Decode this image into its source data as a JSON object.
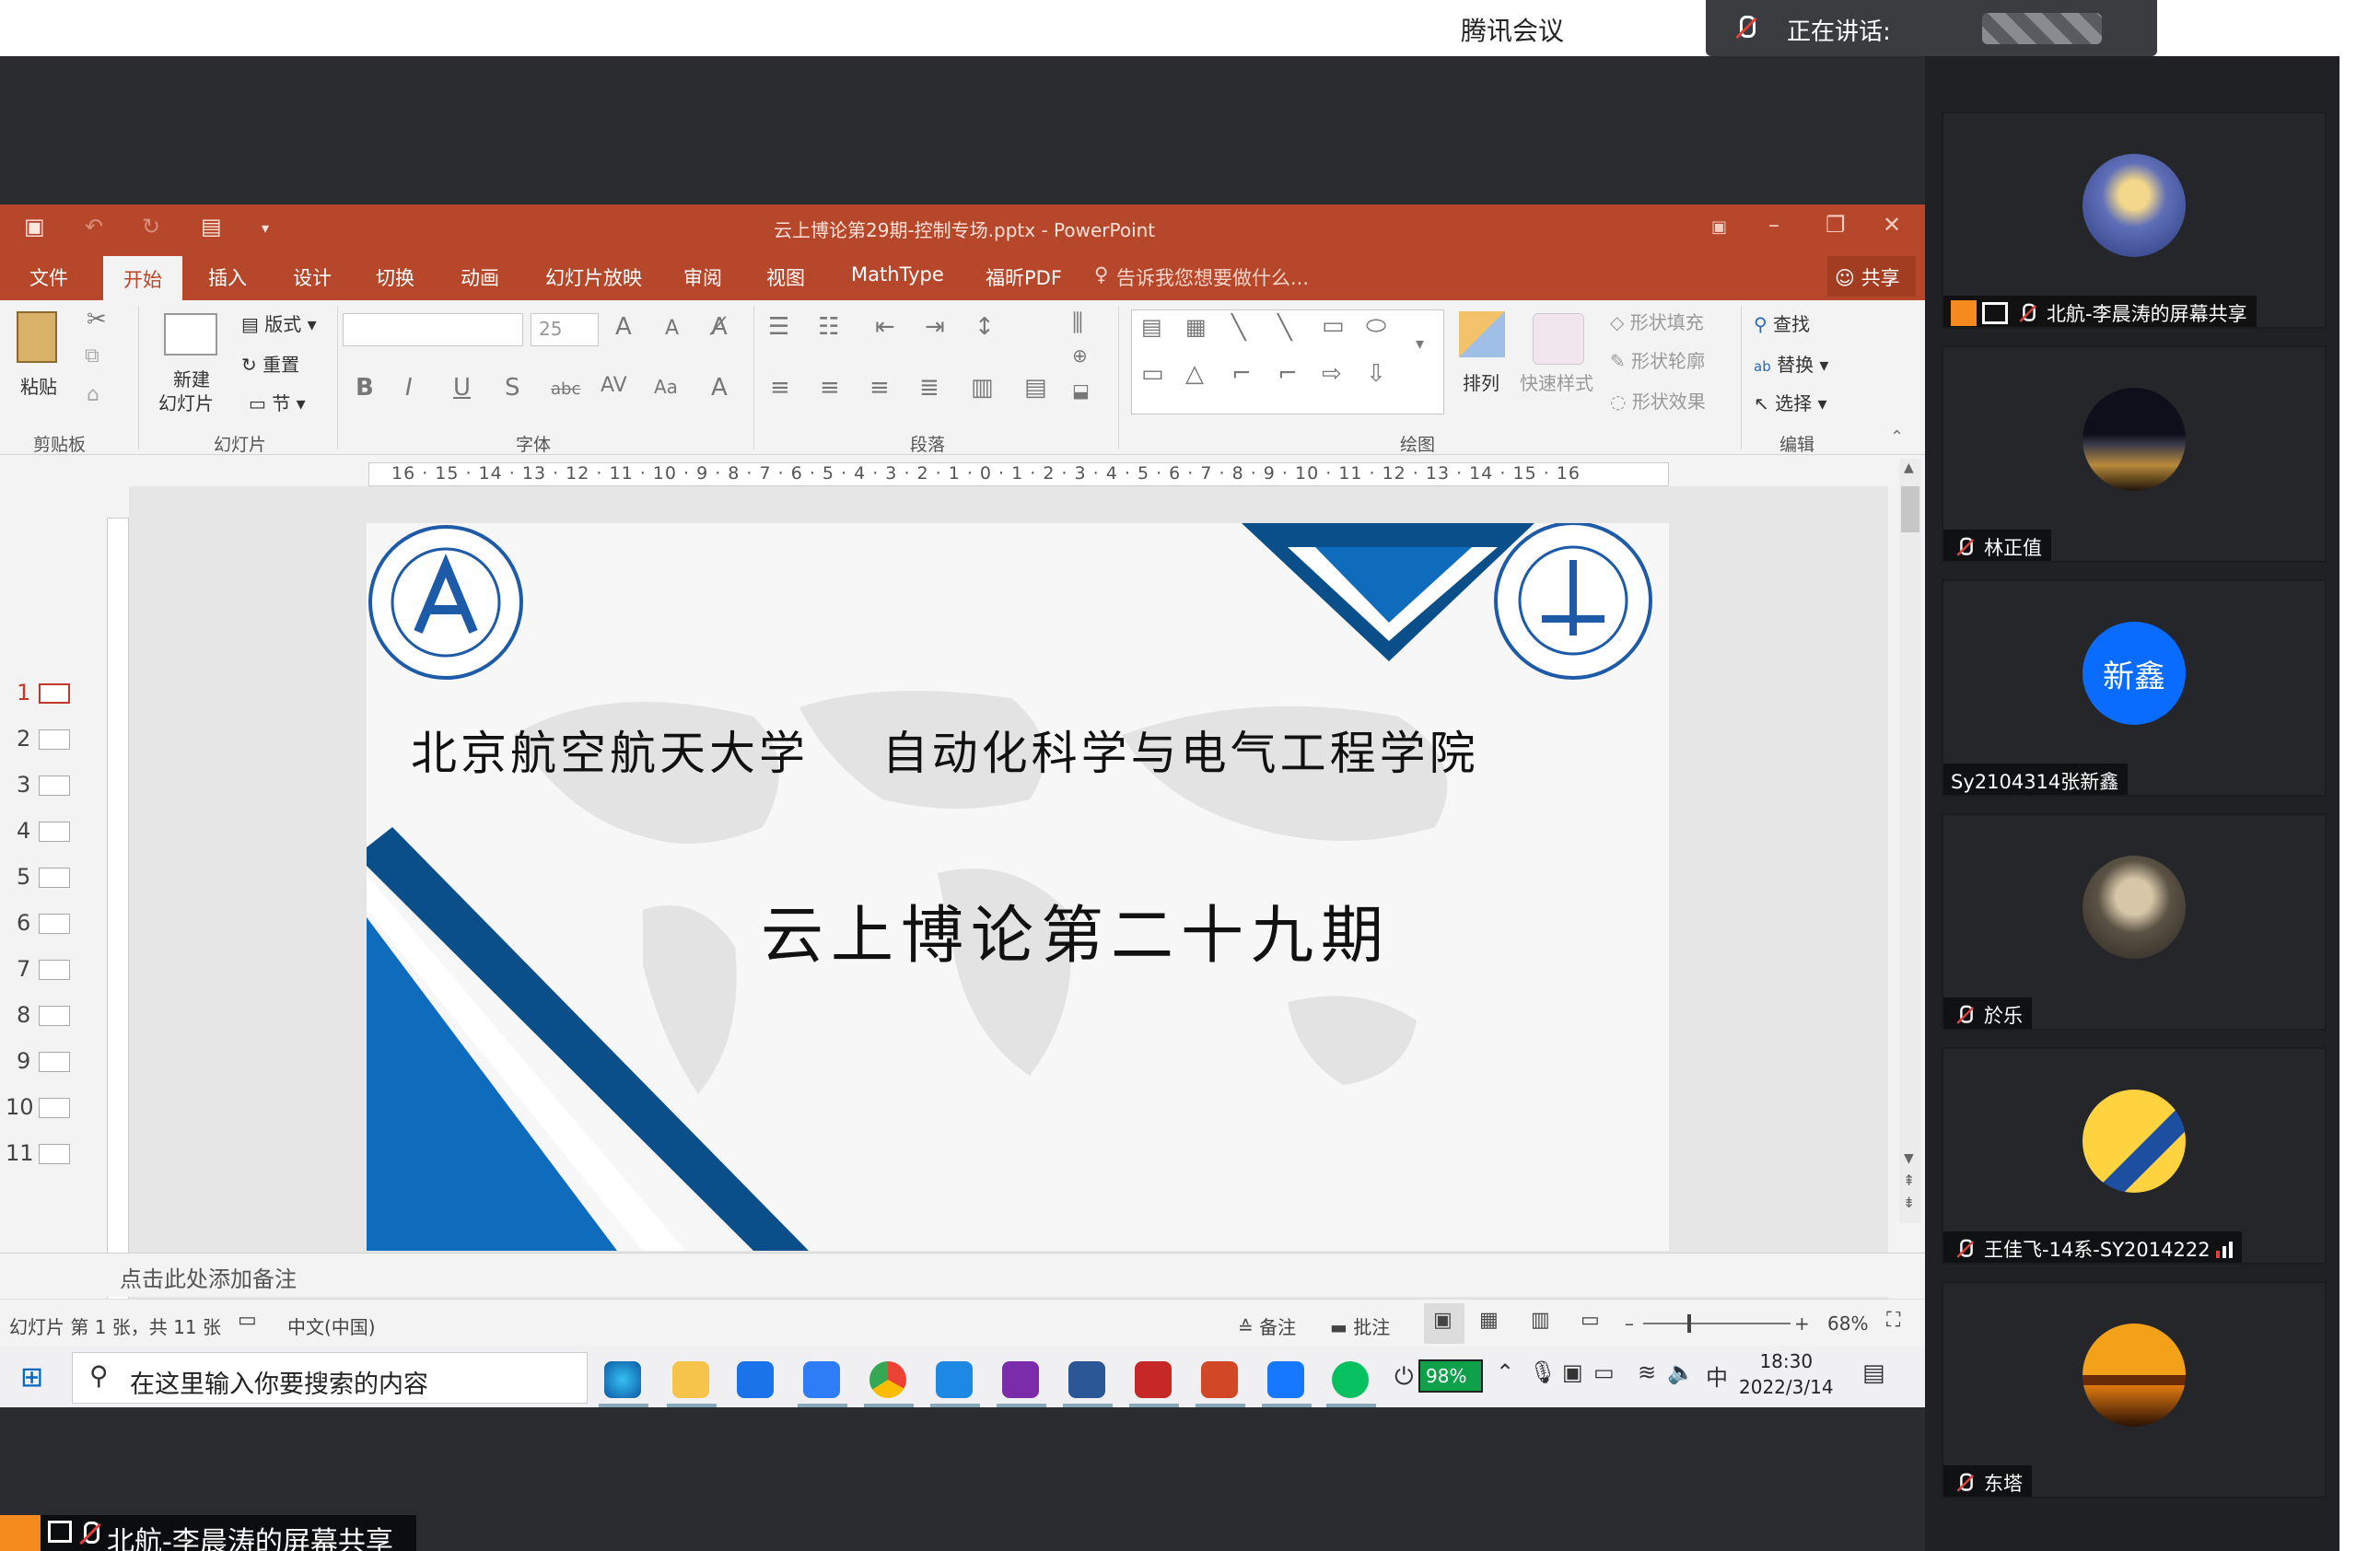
{
  "meeting": {
    "app_title": "腾讯会议",
    "speaking_label": "正在讲话:",
    "share_banner": "北航-李晨涛的屏幕共享"
  },
  "powerpoint": {
    "window_title": "云上博论第29期-控制专场.pptx - PowerPoint",
    "tabs": [
      "文件",
      "开始",
      "插入",
      "设计",
      "切换",
      "动画",
      "幻灯片放映",
      "审阅",
      "视图",
      "MathType",
      "福昕PDF"
    ],
    "active_tab": "开始",
    "tell_me": "告诉我您想要做什么...",
    "share_label": "共享",
    "ribbon": {
      "paste": "粘贴",
      "new_slide": "新建",
      "new_slide2": "幻灯片",
      "layout": "版式",
      "reset": "重置",
      "section": "节",
      "font_size": "25",
      "arrange": "排列",
      "quick_styles": "快速样式",
      "shape_fill": "形状填充",
      "shape_outline": "形状轮廓",
      "shape_effects": "形状效果",
      "find": "查找",
      "replace": "替换",
      "select": "选择",
      "groups": [
        "剪贴板",
        "幻灯片",
        "字体",
        "段落",
        "绘图",
        "编辑"
      ]
    },
    "ruler_text": "16 · 15 · 14 · 13 · 12 · 11 · 10 · 9 · 8 · 7 · 6 · 5 · 4 · 3 · 2 · 1 · 0 · 1 · 2 · 3 · 4 · 5 · 6 · 7 · 8 · 9 · 10 · 11 · 12 · 13 · 14 · 15 · 16",
    "slide_numbers": [
      "1",
      "2",
      "3",
      "4",
      "5",
      "6",
      "7",
      "8",
      "9",
      "10",
      "11"
    ],
    "slide": {
      "heading": "北京航空航天大学    自动化科学与电气工程学院",
      "title": "云上博论第二十九期"
    },
    "notes_placeholder": "点击此处添加备注",
    "status": {
      "slide_info": "幻灯片 第 1 张，共 11 张",
      "language": "中文(中国)",
      "notes": "备注",
      "comments": "批注",
      "zoom": "68%"
    }
  },
  "taskbar": {
    "search_placeholder": "在这里输入你要搜索的内容",
    "battery": "98%",
    "ime": "中",
    "time": "18:30",
    "date": "2022/3/14"
  },
  "participants": [
    {
      "name": "北航-李晨涛的屏幕共享"
    },
    {
      "name": "林正值"
    },
    {
      "name": "Sy2104314张新鑫",
      "avatar_text": "新鑫"
    },
    {
      "name": "於乐"
    },
    {
      "name": "王佳飞-14系-SY2014222"
    },
    {
      "name": "东塔"
    }
  ],
  "colors": {
    "ppt_accent": "#b7472a",
    "slide_blue": "#0f6cbd",
    "slide_navy": "#0b4f8a",
    "avatar_blue": "#0a6cff"
  }
}
